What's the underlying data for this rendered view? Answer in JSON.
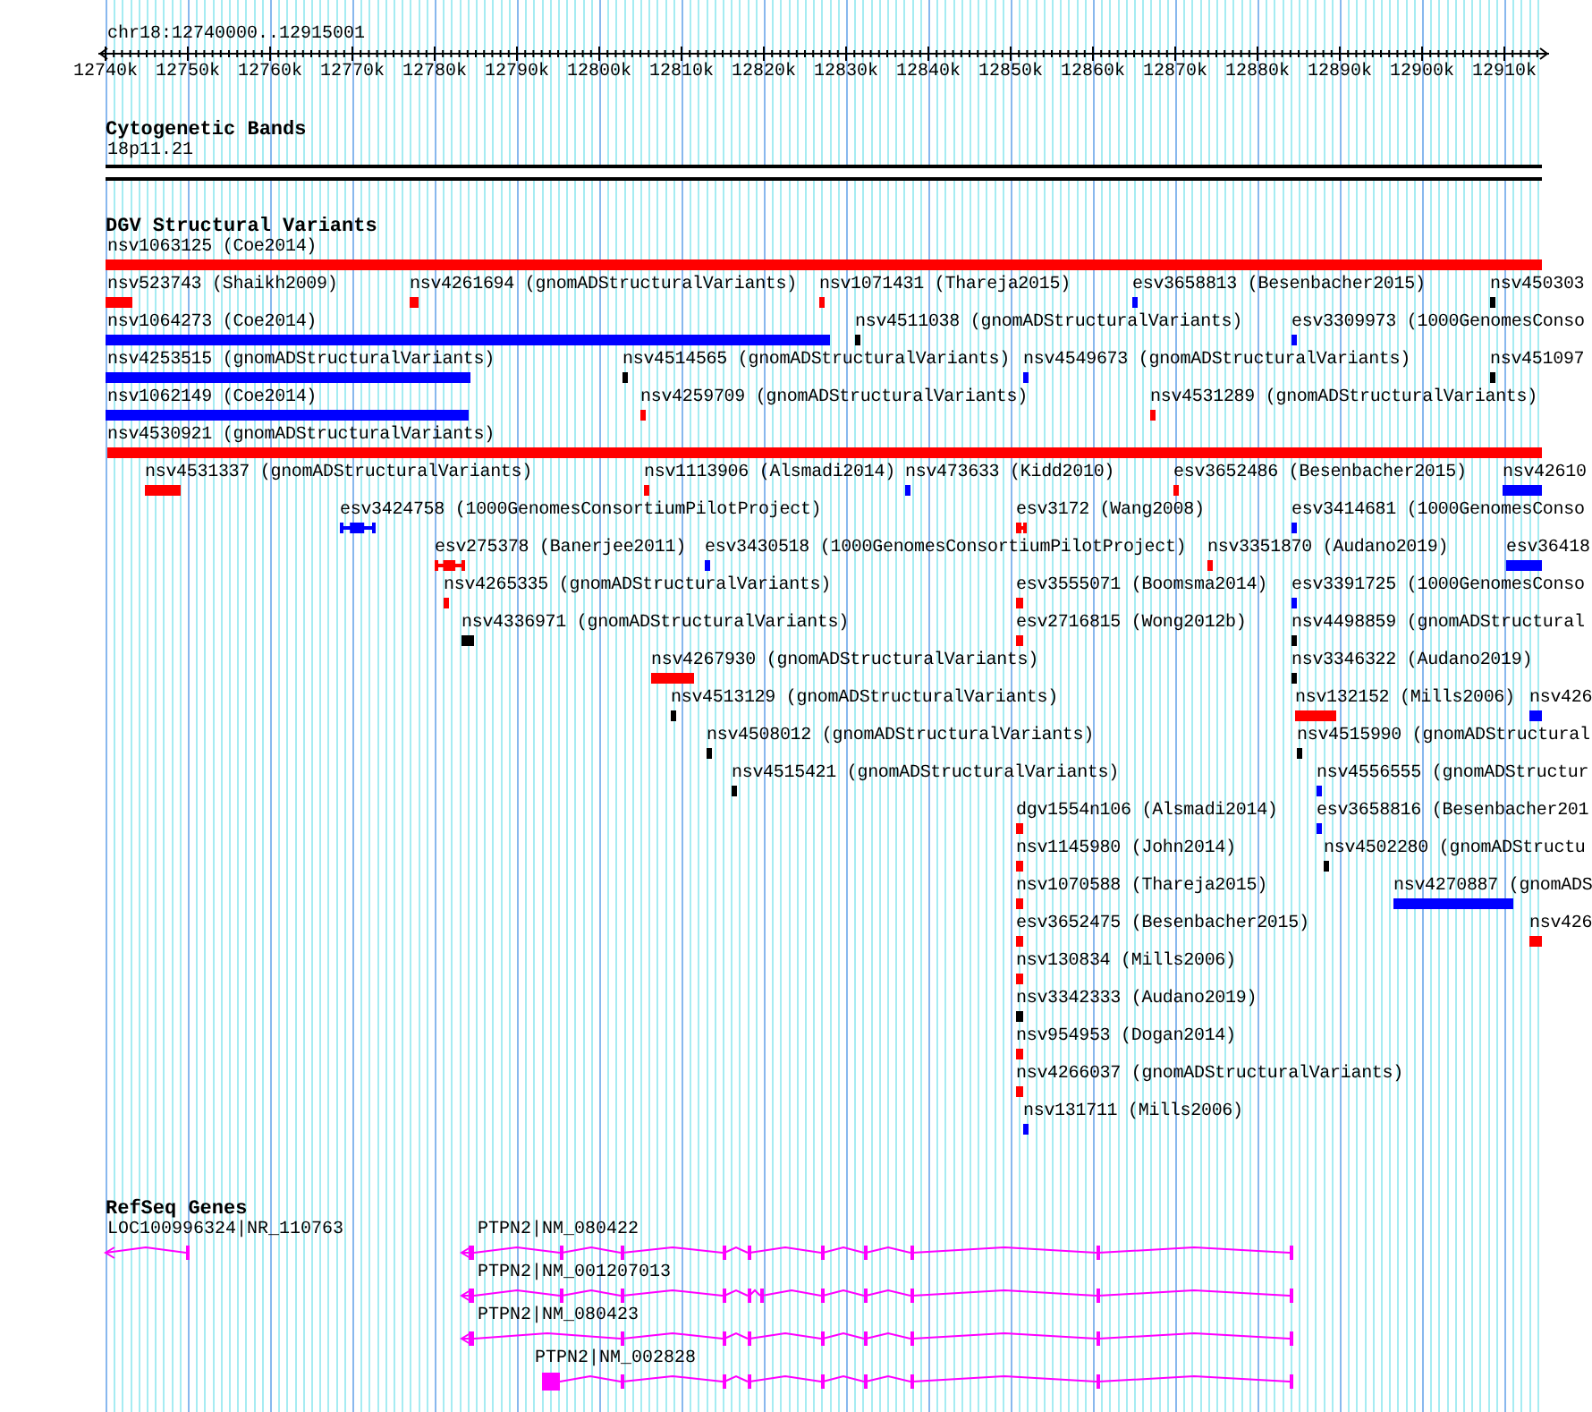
{
  "ruler": {
    "title": "chr18:12740000..12915001",
    "ticks": [
      "12740k",
      "12750k",
      "12760k",
      "12770k",
      "12780k",
      "12790k",
      "12800k",
      "12810k",
      "12820k",
      "12830k",
      "12840k",
      "12850k",
      "12860k",
      "12870k",
      "12880k",
      "12890k",
      "12900k",
      "12910k"
    ]
  },
  "cytogenetic_bands": {
    "title": "Cytogenetic Bands",
    "band": "18p11.21"
  },
  "dgv": {
    "title": "DGV Structural Variants",
    "rows": [
      {
        "features": [
          {
            "label": "nsv1063125 (Coe2014)",
            "color": "#ff0000",
            "kind": "bar"
          }
        ]
      },
      {
        "features": [
          {
            "label": "nsv523743 (Shaikh2009)",
            "color": "#ff0000",
            "kind": "bar"
          },
          {
            "label": "nsv4261694 (gnomADStructuralVariants)",
            "color": "#ff0000",
            "kind": "bar"
          },
          {
            "label": "nsv1071431 (Thareja2015)",
            "color": "#ff0000",
            "kind": "bar"
          },
          {
            "label": "esv3658813 (Besenbacher2015)",
            "color": "#0000ff",
            "kind": "bar"
          },
          {
            "label": "nsv450303",
            "color": "#000000",
            "kind": "bar"
          }
        ]
      },
      {
        "features": [
          {
            "label": "nsv1064273 (Coe2014)",
            "color": "#0000ff",
            "kind": "bar"
          },
          {
            "label": "nsv4511038 (gnomADStructuralVariants)",
            "color": "#000000",
            "kind": "bar"
          },
          {
            "label": "esv3309973 (1000GenomesConso",
            "color": "#0000ff",
            "kind": "bar"
          }
        ]
      },
      {
        "features": [
          {
            "label": "nsv4253515 (gnomADStructuralVariants)",
            "color": "#0000ff",
            "kind": "bar"
          },
          {
            "label": "nsv4514565 (gnomADStructuralVariants)",
            "color": "#000000",
            "kind": "bar"
          },
          {
            "label": "nsv4549673 (gnomADStructuralVariants)",
            "color": "#0000ff",
            "kind": "bar"
          },
          {
            "label": "nsv451097",
            "color": "#000000",
            "kind": "bar"
          }
        ]
      },
      {
        "features": [
          {
            "label": "nsv1062149 (Coe2014)",
            "color": "#0000ff",
            "kind": "bar"
          },
          {
            "label": "nsv4259709 (gnomADStructuralVariants)",
            "color": "#ff0000",
            "kind": "bar"
          },
          {
            "label": "nsv4531289 (gnomADStructuralVariants)",
            "color": "#ff0000",
            "kind": "bar"
          }
        ]
      },
      {
        "features": [
          {
            "label": "nsv4530921 (gnomADStructuralVariants)",
            "color": "#ff0000",
            "kind": "bar"
          }
        ]
      },
      {
        "features": [
          {
            "label": "nsv4531337 (gnomADStructuralVariants)",
            "color": "#ff0000",
            "kind": "bar"
          },
          {
            "label": "nsv1113906 (Alsmadi2014)",
            "color": "#ff0000",
            "kind": "bar"
          },
          {
            "label": "nsv473633 (Kidd2010)",
            "color": "#0000ff",
            "kind": "bar"
          },
          {
            "label": "esv3652486 (Besenbacher2015)",
            "color": "#ff0000",
            "kind": "bar"
          },
          {
            "label": "nsv42610",
            "color": "#0000ff",
            "kind": "bar"
          }
        ]
      },
      {
        "features": [
          {
            "label": "esv3424758 (1000GenomesConsortiumPilotProject)",
            "color": "#0000ff",
            "kind": "interval"
          },
          {
            "label": "esv3172 (Wang2008)",
            "color": "#ff0000",
            "kind": "interval"
          },
          {
            "label": "esv3414681 (1000GenomesConso",
            "color": "#0000ff",
            "kind": "bar"
          }
        ]
      },
      {
        "features": [
          {
            "label": "esv275378 (Banerjee2011)",
            "color": "#ff0000",
            "kind": "interval"
          },
          {
            "label": "esv3430518 (1000GenomesConsortiumPilotProject)",
            "color": "#0000ff",
            "kind": "bar"
          },
          {
            "label": "nsv3351870 (Audano2019)",
            "color": "#ff0000",
            "kind": "bar"
          },
          {
            "label": "esv36418",
            "color": "#0000ff",
            "kind": "bar"
          }
        ]
      },
      {
        "features": [
          {
            "label": "nsv4265335 (gnomADStructuralVariants)",
            "color": "#ff0000",
            "kind": "bar"
          },
          {
            "label": "esv3555071 (Boomsma2014)",
            "color": "#ff0000",
            "kind": "bar"
          },
          {
            "label": "esv3391725 (1000GenomesConso",
            "color": "#0000ff",
            "kind": "bar"
          }
        ]
      },
      {
        "features": [
          {
            "label": "nsv4336971 (gnomADStructuralVariants)",
            "color": "#000000",
            "kind": "bar"
          },
          {
            "label": "esv2716815 (Wong2012b)",
            "color": "#ff0000",
            "kind": "bar"
          },
          {
            "label": "nsv4498859 (gnomADStructural",
            "color": "#000000",
            "kind": "bar"
          }
        ]
      },
      {
        "features": [
          {
            "label": "nsv4267930 (gnomADStructuralVariants)",
            "color": "#ff0000",
            "kind": "bar"
          },
          {
            "label": "nsv3346322 (Audano2019)",
            "color": "#000000",
            "kind": "bar"
          }
        ]
      },
      {
        "features": [
          {
            "label": "nsv4513129 (gnomADStructuralVariants)",
            "color": "#000000",
            "kind": "bar"
          },
          {
            "label": "nsv132152 (Mills2006)",
            "color": "#ff0000",
            "kind": "bar"
          },
          {
            "label": "nsv426",
            "color": "#0000ff",
            "kind": "bar"
          }
        ]
      },
      {
        "features": [
          {
            "label": "nsv4508012 (gnomADStructuralVariants)",
            "color": "#000000",
            "kind": "bar"
          },
          {
            "label": "nsv4515990 (gnomADStructural",
            "color": "#000000",
            "kind": "bar"
          }
        ]
      },
      {
        "features": [
          {
            "label": "nsv4515421 (gnomADStructuralVariants)",
            "color": "#000000",
            "kind": "bar"
          },
          {
            "label": "nsv4556555 (gnomADStructur",
            "color": "#0000ff",
            "kind": "bar"
          }
        ]
      },
      {
        "features": [
          {
            "label": "dgv1554n106 (Alsmadi2014)",
            "color": "#ff0000",
            "kind": "bar"
          },
          {
            "label": "esv3658816 (Besenbacher201",
            "color": "#0000ff",
            "kind": "bar"
          }
        ]
      },
      {
        "features": [
          {
            "label": "nsv1145980 (John2014)",
            "color": "#ff0000",
            "kind": "bar"
          },
          {
            "label": "nsv4502280 (gnomADStructu",
            "color": "#000000",
            "kind": "bar"
          }
        ]
      },
      {
        "features": [
          {
            "label": "nsv1070588 (Thareja2015)",
            "color": "#ff0000",
            "kind": "bar"
          },
          {
            "label": "nsv4270887 (gnomADS",
            "color": "#0000ff",
            "kind": "bar"
          }
        ]
      },
      {
        "features": [
          {
            "label": "esv3652475 (Besenbacher2015)",
            "color": "#ff0000",
            "kind": "bar"
          },
          {
            "label": "nsv426",
            "color": "#ff0000",
            "kind": "bar"
          }
        ]
      },
      {
        "features": [
          {
            "label": "nsv130834 (Mills2006)",
            "color": "#ff0000",
            "kind": "bar"
          }
        ]
      },
      {
        "features": [
          {
            "label": "nsv3342333 (Audano2019)",
            "color": "#000000",
            "kind": "bar"
          }
        ]
      },
      {
        "features": [
          {
            "label": "nsv954953 (Dogan2014)",
            "color": "#ff0000",
            "kind": "bar"
          }
        ]
      },
      {
        "features": [
          {
            "label": "nsv4266037 (gnomADStructuralVariants)",
            "color": "#ff0000",
            "kind": "bar"
          }
        ]
      },
      {
        "features": [
          {
            "label": "nsv131711 (Mills2006)",
            "color": "#0000ff",
            "kind": "bar"
          }
        ]
      }
    ]
  },
  "refseq": {
    "title": "RefSeq Genes",
    "genes": [
      {
        "label": "LOC100996324|NR_110763"
      },
      {
        "label": "PTPN2|NM_080422"
      },
      {
        "label": "PTPN2|NM_001207013"
      },
      {
        "label": "PTPN2|NM_080423"
      },
      {
        "label": "PTPN2|NM_002828"
      }
    ]
  }
}
